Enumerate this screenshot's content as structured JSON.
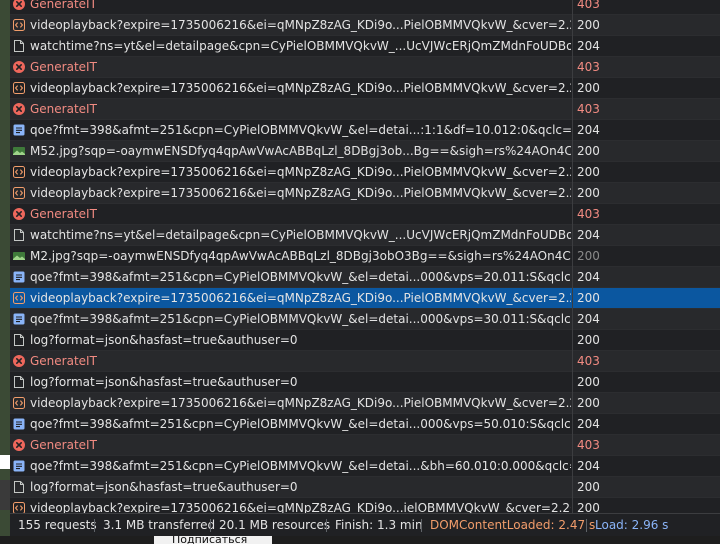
{
  "requests": [
    {
      "name": "GenerateIT",
      "status": "403",
      "type": "error"
    },
    {
      "name": "videoplayback?expire=1735006216&ei=qMNpZ8zAG_KDi9o...PielOBMMVQkvW_&cver=2.20241219...",
      "status": "200",
      "type": "media"
    },
    {
      "name": "watchtime?ns=yt&el=detailpage&cpn=CyPielOBMMVQkvW_...UcVJWcERjQmZMdnFoUDBoa1U4d3...",
      "status": "204",
      "type": "doc"
    },
    {
      "name": "GenerateIT",
      "status": "403",
      "type": "error"
    },
    {
      "name": "videoplayback?expire=1735006216&ei=qMNpZ8zAG_KDi9o...PielOBMMVQkvW_&cver=2.20241219...",
      "status": "200",
      "type": "media"
    },
    {
      "name": "GenerateIT",
      "status": "403",
      "type": "error"
    },
    {
      "name": "qoe?fmt=398&afmt=251&cpn=CyPielOBMMVQkvW_&el=detai...:1:1&df=10.012:0&qclc=ChBDeVB...",
      "status": "204",
      "type": "xhr"
    },
    {
      "name": "M52.jpg?sqp=-oaymwENSDfyq4qpAwVwAcABBqLzl_8DBgj3ob...Bg==&sigh=rs%24AOn4CLDEn5U...",
      "status": "200",
      "type": "image"
    },
    {
      "name": "videoplayback?expire=1735006216&ei=qMNpZ8zAG_KDi9o...PielOBMMVQkvW_&cver=2.20241219...",
      "status": "200",
      "type": "media"
    },
    {
      "name": "videoplayback?expire=1735006216&ei=qMNpZ8zAG_KDi9o...PielOBMMVQkvW_&cver=2.20241219...",
      "status": "200",
      "type": "media"
    },
    {
      "name": "GenerateIT",
      "status": "403",
      "type": "error"
    },
    {
      "name": "watchtime?ns=yt&el=detailpage&cpn=CyPielOBMMVQkvW_...UcVJWcERjQmZMdnFoUDBoa1U4d3...",
      "status": "204",
      "type": "doc"
    },
    {
      "name": "M2.jpg?sqp=-oaymwENSDfyq4qpAwVwAcABBqLzl_8DBgj3obO3Bg==&sigh=rs%24AOn4CLCKQ0-1...",
      "status": "200",
      "type": "image",
      "dim": true
    },
    {
      "name": "qoe?fmt=398&afmt=251&cpn=CyPielOBMMVQkvW_&el=detai...000&vps=20.011:S&qclc=ChBDeV...",
      "status": "204",
      "type": "xhr"
    },
    {
      "name": "videoplayback?expire=1735006216&ei=qMNpZ8zAG_KDi9o...PielOBMMVQkvW_&cver=2.20241219...",
      "status": "200",
      "type": "media",
      "selected": true
    },
    {
      "name": "qoe?fmt=398&afmt=251&cpn=CyPielOBMMVQkvW_&el=detai...000&vps=30.011:S&qclc=ChBDeV...",
      "status": "204",
      "type": "xhr"
    },
    {
      "name": "log?format=json&hasfast=true&authuser=0",
      "status": "200",
      "type": "doc"
    },
    {
      "name": "GenerateIT",
      "status": "403",
      "type": "error"
    },
    {
      "name": "log?format=json&hasfast=true&authuser=0",
      "status": "200",
      "type": "doc"
    },
    {
      "name": "videoplayback?expire=1735006216&ei=qMNpZ8zAG_KDi9o...PielOBMMVQkvW_&cver=2.20241219...",
      "status": "200",
      "type": "media"
    },
    {
      "name": "qoe?fmt=398&afmt=251&cpn=CyPielOBMMVQkvW_&el=detai...000&vps=50.010:S&qclc=ChBDeV...",
      "status": "204",
      "type": "xhr"
    },
    {
      "name": "GenerateIT",
      "status": "403",
      "type": "error"
    },
    {
      "name": "qoe?fmt=398&afmt=251&cpn=CyPielOBMMVQkvW_&el=detai...&bh=60.010:0.000&qclc=ChBDeV...",
      "status": "204",
      "type": "xhr"
    },
    {
      "name": "log?format=json&hasfast=true&authuser=0",
      "status": "200",
      "type": "doc"
    },
    {
      "name": "videoplayback?expire=1735006216&ei=qMNpZ8zAG_KDi9o...ielOBMMVQkvW_&cver=2.20241219...",
      "status": "200",
      "type": "media"
    }
  ],
  "footer": {
    "requests": "155 requests",
    "transferred": "3.1 MB transferred",
    "resources": "20.1 MB resources",
    "finish": "Finish: 1.3 min",
    "dom_content_loaded": "DOMContentLoaded: 2.47 s",
    "load": "Load: 2.96 s"
  },
  "page_behind": {
    "subscribe_label": "Подписаться"
  },
  "colors": {
    "panel_bg": "#202124",
    "error": "#f28b82",
    "selected": "#0b57a0",
    "dom_content_loaded": "#f29d6b",
    "load": "#8ab4f8",
    "media_icon": "#f29d6b",
    "xhr_icon": "#8ab4f8"
  }
}
